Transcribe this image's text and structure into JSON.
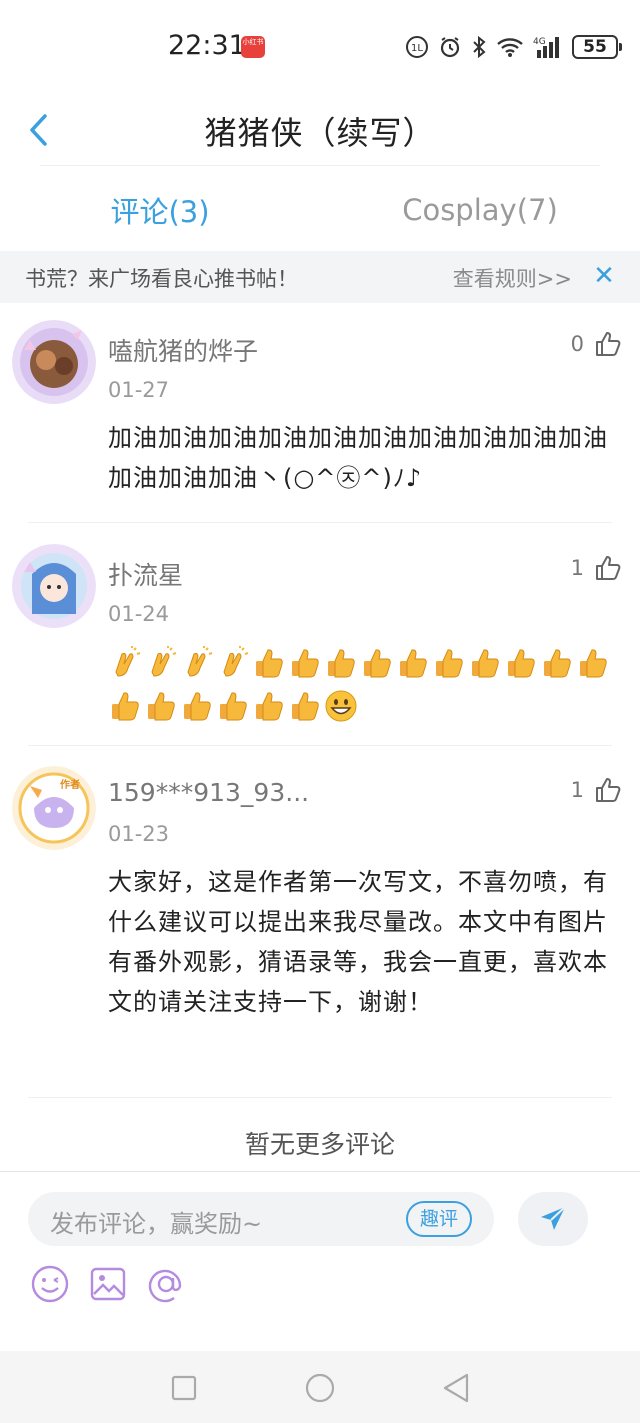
{
  "status_bar": {
    "time": "22:31",
    "app_badge": "小红书",
    "battery": "55",
    "network": "4G"
  },
  "header": {
    "title": "猪猪侠（续写）"
  },
  "tabs": [
    {
      "label": "评论(3)",
      "active": true
    },
    {
      "label": "Cosplay(7)",
      "active": false
    }
  ],
  "notice": {
    "text": "书荒？来广场看良心推书帖！",
    "link": "查看规则>>",
    "close": "✕"
  },
  "comments": [
    {
      "username": "嗑航猪的烨子",
      "likes": "0",
      "date": "01-27",
      "content": "加油加油加油加油加油加油加油加油加油加油加油加油加油丶(○^㉨^)ﾉ♪"
    },
    {
      "username": "扑流星",
      "likes": "1",
      "date": "01-24",
      "content_emojis": [
        "clap",
        "clap",
        "clap",
        "clap",
        "thumb",
        "thumb",
        "thumb",
        "thumb",
        "thumb",
        "thumb",
        "thumb",
        "thumb",
        "thumb",
        "thumb",
        "thumb",
        "thumb",
        "thumb",
        "thumb",
        "thumb",
        "thumb",
        "grin"
      ]
    },
    {
      "username": "159***913_93...",
      "likes": "1",
      "date": "01-23",
      "author_badge": "作者",
      "content": "大家好，这是作者第一次写文，不喜勿喷，有什么建议可以提出来我尽量改。本文中有图片有番外观影，猜语录等，我会一直更，喜欢本文的请关注支持一下，谢谢！"
    }
  ],
  "no_more": "暂无更多评论",
  "input": {
    "placeholder": "发布评论，赢奖励~",
    "fun_label": "趣评"
  },
  "colors": {
    "accent": "#3ba0e0",
    "icon_purple": "#b58be0"
  }
}
